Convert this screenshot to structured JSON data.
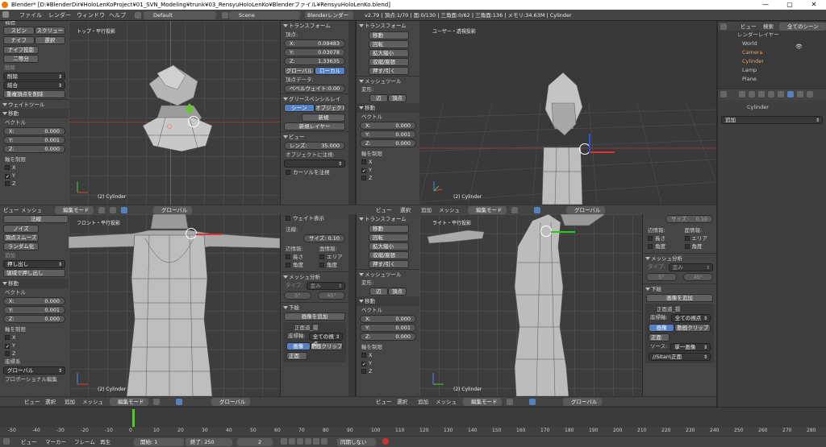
{
  "window": {
    "title": "Blender* [D:¥BlenderDir¥HoloLenKoProject¥01_SVN_Modeling¥trunk¥03_RensyuHoloLenKo¥Blenderファイル¥RensyuHoloLenKo.blend]",
    "min": "—",
    "max": "▢",
    "close": "✕"
  },
  "info": {
    "menus": [
      "ファイル",
      "レンダー",
      "ウィンドウ",
      "ヘルプ"
    ],
    "layout": "Default",
    "scene": "Scene",
    "engine": "Blenderレンダー",
    "stats": "v2.79 | 頂点:1/70 | 面:0/130 | 三角面:0/62 | 三角面:136 | メモリ:34.63M | Cylinder"
  },
  "viewports": {
    "tl": {
      "label": "トップ・平行投影",
      "obj": "(2) Cylinder"
    },
    "tr": {
      "label": "ユーザー・透視投影",
      "obj": "(2) Cylinder"
    },
    "bl": {
      "label": "フロント・平行投影",
      "obj": "(2) Cylinder"
    },
    "br": {
      "label": "ライト・平行投影",
      "obj": "(2) Cylinder"
    }
  },
  "toolL1": {
    "items": [
      "補間",
      "スピン",
      "スクリュー",
      "ナイフ",
      "選択",
      "ナイフ投影",
      "二等分"
    ],
    "del": "削除",
    "delsel": "削除",
    "merge": "結合",
    "remdup": "重複頂点を削除",
    "weight": "ウェイトツール",
    "move": "移動",
    "vector": "ベクトル",
    "x": "X:",
    "xv": "0.000",
    "y": "Y:",
    "yv": "0.001",
    "z": "Z:",
    "zv": "0.000",
    "axis": "軸を制限",
    "ax": "X",
    "ay": "Y",
    "az": "Z",
    "check": "✓"
  },
  "toolL2": {
    "items": [
      "法線",
      "ノイズ",
      "頂点スムーズ",
      "ランダム化"
    ],
    "add": "追加",
    "extrude": "押し出し",
    "extrude2": "領域で押し出し",
    "move": "移動",
    "vector": "ベクトル",
    "x": "X:",
    "xv": "0.000",
    "y": "Y:",
    "yv": "0.001",
    "z": "Z:",
    "zv": "0.000",
    "axis": "軸を制限",
    "ax": "X",
    "ay": "Y",
    "az": "Z",
    "orient": "座標系",
    "global": "グローバル",
    "prop": "プロポーショナル編集",
    "check": "✓"
  },
  "npanelTL": {
    "transform": "トランスフォーム",
    "vertex": "頂点:",
    "x": "X:",
    "xv": "0.09483",
    "y": "Y:",
    "yv": "0.03078",
    "z": "Z:",
    "zv": "1.33635",
    "global": "グローバル",
    "local": "ローカル",
    "vdata": "頂点データ:",
    "bevel": "ベベルウェイト:",
    "bevelv": "0.00",
    "gp": "グリースペンシルレイ",
    "scene": "シーン",
    "object": "オブジェクト",
    "new": "新規",
    "newlayer": "新規レイヤー",
    "view": "ビュー",
    "lens": "レンズ:",
    "lensv": "35.000",
    "lockobj": "オブジェクトに注視:",
    "lockcursor": "カーソルを注視"
  },
  "toolTR": {
    "transform": "トランスフォーム",
    "items": [
      "移動",
      "回転",
      "拡大縮小",
      "収縮/膨張",
      "押す/引く"
    ],
    "meshtools": "メッシュツール",
    "deform": "変形:",
    "slide": "辺",
    "vtx": "頂点",
    "move": "移動",
    "vector": "ベクトル",
    "x": "X:",
    "xv": "0.000",
    "y": "Y:",
    "yv": "0.001",
    "z": "Z:",
    "zv": "0.000",
    "axis": "軸を制限",
    "ax": "X",
    "ay": "Y",
    "az": "Z",
    "check": "✓"
  },
  "npanelBL": {
    "weight": "ウェイト表示",
    "normal": "法線:",
    "size": "サイズ:",
    "sizev": "0.10",
    "edgeinfo": "辺情報:",
    "faceinfo": "面情報:",
    "length": "長さ",
    "area": "エリア",
    "angle": "角度",
    "angle2": "角度",
    "analysis": "メッシュ分析",
    "type": "タイプ:",
    "typev": "歪み",
    "min": "5°",
    "max": "45°",
    "bg": "下絵",
    "addimage": "画像を追加",
    "front": "正面道_揚",
    "axis": "座標軸:",
    "allview": "全ての視点",
    "image": "画像",
    "movieclip": "動画クリップ",
    "f": "正面"
  },
  "toolBR": {
    "transform": "トランスフォーム",
    "items": [
      "移動",
      "回転",
      "拡大縮小",
      "収縮/膨張",
      "押す/引く"
    ],
    "meshtools": "メッシュツール",
    "deform": "変形:",
    "slide": "辺",
    "vtx": "頂点",
    "move": "移動",
    "vector": "ベクトル",
    "x": "X:",
    "xv": "0.000",
    "y": "Y:",
    "yv": "0.001",
    "z": "Z:",
    "zv": "0.000",
    "axis": "軸を制限",
    "ax": "X",
    "ay": "Y",
    "az": "Z",
    "check": "✓"
  },
  "npanelBR": {
    "size": "サイズ:",
    "sizev": "0.10",
    "edgeinfo": "辺情報:",
    "faceinfo": "面情報:",
    "length": "長さ",
    "area": "エリア",
    "angle": "角度",
    "angle2": "角度",
    "analysis": "メッシュ分析",
    "type": "タイプ:",
    "typev": "歪み",
    "min": "5°",
    "max": "45°",
    "bg": "下絵",
    "addimage": "画像を追加",
    "front": "正面道_揚",
    "axis": "座標軸:",
    "allview": "全ての視点",
    "image": "画像",
    "movieclip": "動画クリップ",
    "f": "正面",
    "source": "ソース:",
    "single": "単一画像",
    "file": "//Sitan\\正面"
  },
  "outliner": {
    "view": "ビュー",
    "search": "検索",
    "allscenes": "全てのシーン",
    "items": [
      "レンダーレイヤー",
      "World",
      "Camera",
      "Cylinder",
      "Lamp",
      "Plane"
    ]
  },
  "props": {
    "obj": "Cylinder",
    "add": "追加"
  },
  "vheader": {
    "view": "ビュー",
    "select": "選択",
    "add": "追加",
    "mesh": "メッシュ",
    "mode": "編集モード",
    "global": "グローバル"
  },
  "timeline": {
    "ticks": [
      "-50",
      "-40",
      "-30",
      "-20",
      "-10",
      "0",
      "10",
      "20",
      "30",
      "40",
      "50",
      "60",
      "70",
      "80",
      "90",
      "100",
      "110",
      "120",
      "130",
      "140",
      "150",
      "160",
      "170",
      "180",
      "190",
      "200",
      "210",
      "220",
      "230",
      "240",
      "250",
      "260",
      "270",
      "280"
    ],
    "view": "ビュー",
    "marker": "マーカー",
    "frame": "フレーム",
    "play": "再生",
    "start": "開始:",
    "startv": "1",
    "end": "終了:",
    "endv": "250",
    "cur": "2",
    "sync": "同期しない"
  }
}
